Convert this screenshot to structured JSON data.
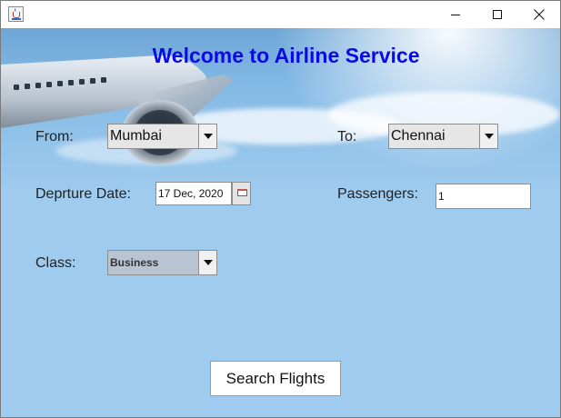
{
  "window": {
    "title": "",
    "controls": [
      "minimize",
      "maximize",
      "close"
    ]
  },
  "header": {
    "title": "Welcome to Airline Service"
  },
  "form": {
    "from_label": "From:",
    "from_value": "Mumbai",
    "to_label": "To:",
    "to_value": "Chennai",
    "date_label": "Deprture Date:",
    "date_value": "17 Dec, 2020",
    "passengers_label": "Passengers:",
    "passengers_value": "1",
    "class_label": "Class:",
    "class_value": "Business"
  },
  "actions": {
    "search_label": "Search Flights"
  },
  "icons": {
    "app": "java-cup-icon",
    "calendar": "calendar-icon",
    "dropdown": "chevron-down-icon"
  },
  "colors": {
    "title": "#0a0ae8",
    "background": "#9ecbee"
  }
}
